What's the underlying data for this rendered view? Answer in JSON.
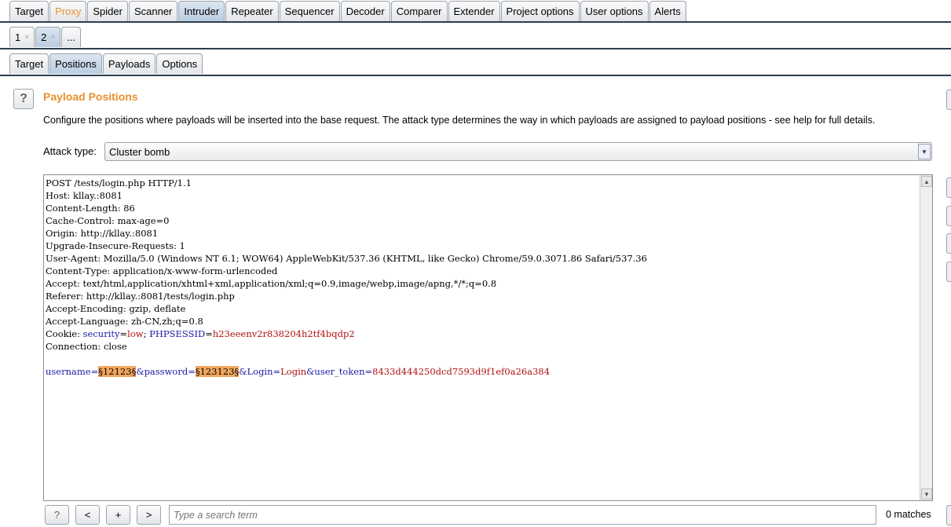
{
  "main_tabs": [
    {
      "label": "Target"
    },
    {
      "label": "Proxy",
      "color": "#e8912c"
    },
    {
      "label": "Spider"
    },
    {
      "label": "Scanner"
    },
    {
      "label": "Intruder",
      "active": true
    },
    {
      "label": "Repeater"
    },
    {
      "label": "Sequencer"
    },
    {
      "label": "Decoder"
    },
    {
      "label": "Comparer"
    },
    {
      "label": "Extender"
    },
    {
      "label": "Project options"
    },
    {
      "label": "User options"
    },
    {
      "label": "Alerts"
    }
  ],
  "attack_tabs": [
    {
      "label": "1",
      "close": "×"
    },
    {
      "label": "2",
      "close": "×",
      "active": true
    },
    {
      "label": "..."
    }
  ],
  "sub_tabs": [
    {
      "label": "Target"
    },
    {
      "label": "Positions",
      "active": true
    },
    {
      "label": "Payloads"
    },
    {
      "label": "Options"
    }
  ],
  "section": {
    "help": "?",
    "title": "Payload Positions",
    "title_color": "#e8912c",
    "description": "Configure the positions where payloads will be inserted into the base request. The attack type determines the way in which payloads are assigned to payload positions - see help for full details."
  },
  "attack_type": {
    "label": "Attack type:",
    "value": "Cluster bomb"
  },
  "colors": {
    "name": "#1a1aa6",
    "value": "#b01010"
  },
  "request_lines": [
    [
      {
        "t": "POST /tests/login.php HTTP/1.1"
      }
    ],
    [
      {
        "t": "Host: kllay.:8081"
      }
    ],
    [
      {
        "t": "Content-Length: 86"
      }
    ],
    [
      {
        "t": "Cache-Control: max-age=0"
      }
    ],
    [
      {
        "t": "Origin: http://kllay.:8081"
      }
    ],
    [
      {
        "t": "Upgrade-Insecure-Requests: 1"
      }
    ],
    [
      {
        "t": "User-Agent: Mozilla/5.0 (Windows NT 6.1; WOW64) AppleWebKit/537.36 (KHTML, like Gecko) Chrome/59.0.3071.86 Safari/537.36"
      }
    ],
    [
      {
        "t": "Content-Type: application/x-www-form-urlencoded"
      }
    ],
    [
      {
        "t": "Accept: text/html,application/xhtml+xml,application/xml;q=0.9,image/webp,image/apng,*/*;q=0.8"
      }
    ],
    [
      {
        "t": "Referer: http://kllay.:8081/tests/login.php"
      }
    ],
    [
      {
        "t": "Accept-Encoding: gzip, deflate"
      }
    ],
    [
      {
        "t": "Accept-Language: zh-CN,zh;q=0.8"
      }
    ],
    [
      {
        "t": "Cookie: "
      },
      {
        "t": "security",
        "c": "name"
      },
      {
        "t": "="
      },
      {
        "t": "low",
        "c": "value"
      },
      {
        "t": "; "
      },
      {
        "t": "PHPSESSID",
        "c": "name"
      },
      {
        "t": "="
      },
      {
        "t": "h23eeenv2r838204h2tf4bqdp2",
        "c": "value"
      }
    ],
    [
      {
        "t": "Connection: close"
      }
    ],
    [
      {
        "t": " "
      }
    ],
    [
      {
        "t": "username",
        "c": "name"
      },
      {
        "t": "=",
        "c": "name"
      },
      {
        "t": "§12123§",
        "m": true
      },
      {
        "t": "&password=",
        "c": "name"
      },
      {
        "t": "§123123§",
        "m": true
      },
      {
        "t": "&Login",
        "c": "name"
      },
      {
        "t": "=",
        "c": "name"
      },
      {
        "t": "Login",
        "c": "value"
      },
      {
        "t": "&user_token",
        "c": "name"
      },
      {
        "t": "=",
        "c": "name"
      },
      {
        "t": "8433d444250dcd7593d9f1ef0a26a384",
        "c": "value"
      }
    ]
  ],
  "search": {
    "help": "?",
    "prev": "<",
    "add": "+",
    "next": ">",
    "placeholder": "Type a search term",
    "matches": "0 matches"
  }
}
